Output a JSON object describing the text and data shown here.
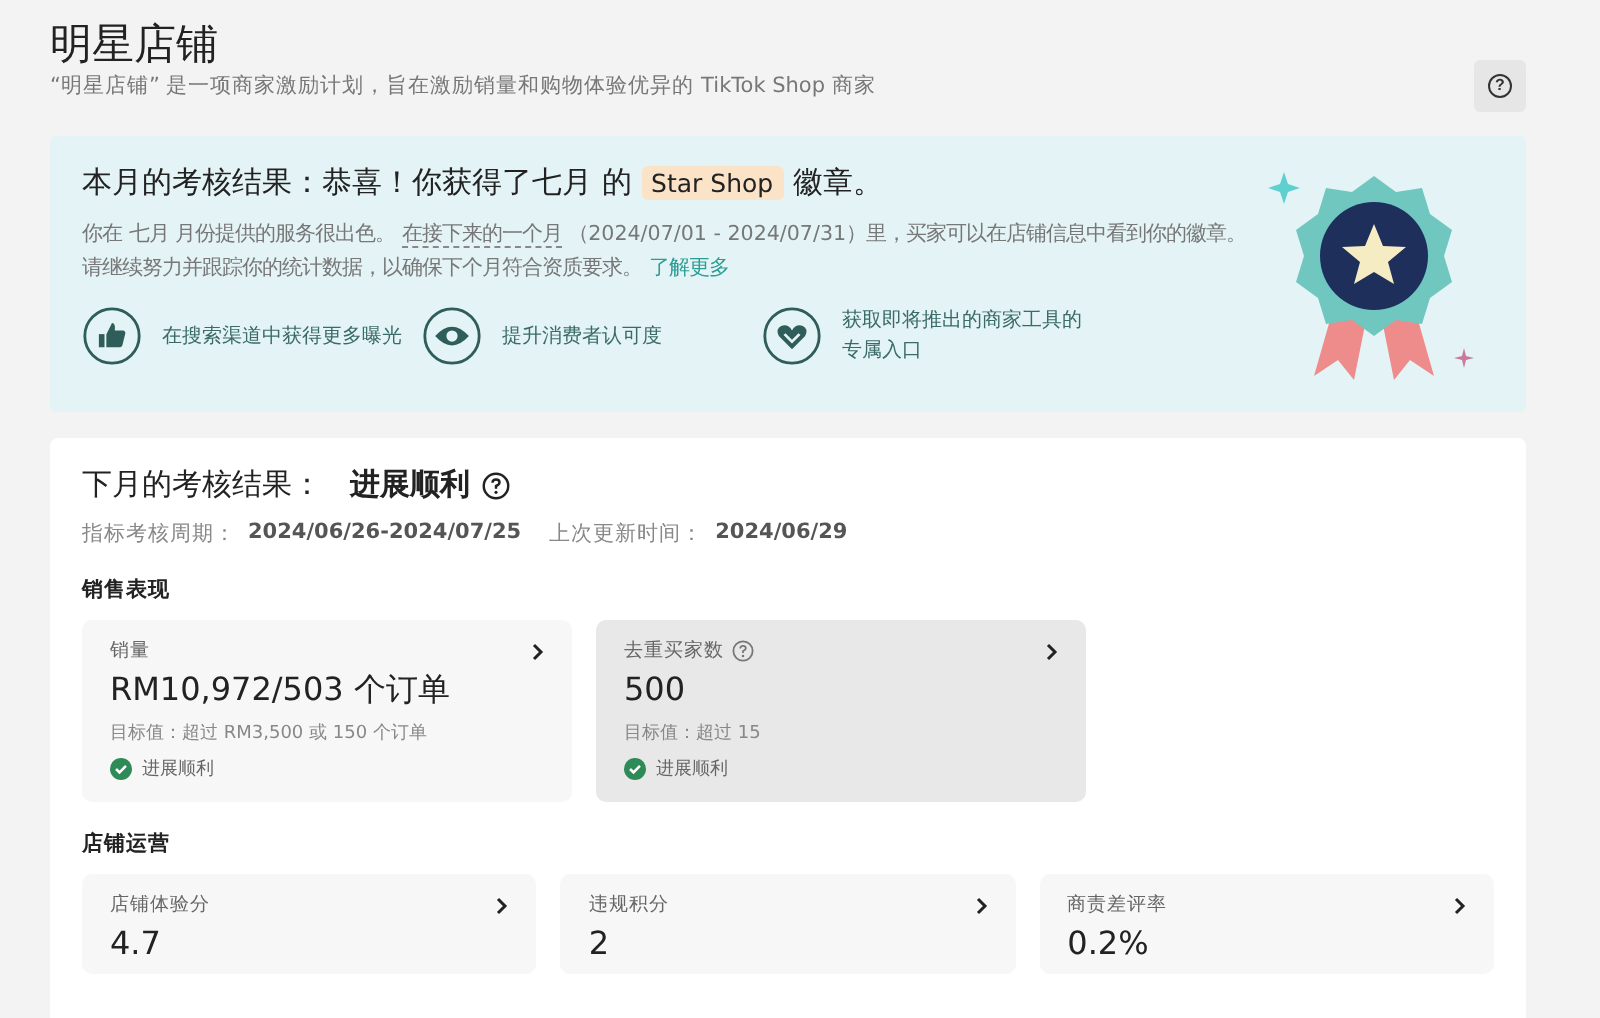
{
  "header": {
    "title": "明星店铺",
    "subtitle": "“明星店铺” 是一项商家激励计划，旨在激励销量和购物体验优异的 TikTok Shop 商家",
    "help_button": "?"
  },
  "banner": {
    "headline_before": "本月的考核结果：恭喜！你获得了七月 的",
    "highlight": "Star Shop",
    "headline_after": "徽章。",
    "text_before": "你在 七月 月份提供的服务很出色。",
    "text_term": "在接下来的一个月",
    "text_after": "（2024/07/01 - 2024/07/31）里，买家可以在店铺信息中看到你的徽章。请继续努力并跟踪你的统计数据，以确保下个月符合资质要求。",
    "link": "了解更多",
    "benefits": [
      {
        "kind": "thumb",
        "label": "在搜索渠道中获得更多曝光"
      },
      {
        "kind": "eye",
        "label": "提升消费者认可度"
      },
      {
        "kind": "heart",
        "label": "获取即将推出的商家工具的专属入口"
      }
    ]
  },
  "next_month": {
    "title": "下月的考核结果：",
    "status": "进展顺利",
    "meta": [
      {
        "label": "指标考核周期：",
        "value": "2024/06/26-2024/07/25"
      },
      {
        "label": "上次更新时间：",
        "value": "2024/06/29"
      }
    ],
    "sections": [
      {
        "title": "销售表现",
        "cards": [
          {
            "name": "销量",
            "help": false,
            "value": "RM10,972/503 个订单",
            "target": "目标值：超过 RM3,500 或 150 个订单",
            "status": "进展顺利",
            "selected": false
          },
          {
            "name": "去重买家数",
            "help": true,
            "value": "500",
            "target": "目标值：超过 15",
            "status": "进展顺利",
            "selected": true
          }
        ]
      },
      {
        "title": "店铺运营",
        "cards": [
          {
            "name": "店铺体验分",
            "help": false,
            "value": "4.7",
            "selected": false
          },
          {
            "name": "违规积分",
            "help": false,
            "value": "2",
            "selected": false
          },
          {
            "name": "商责差评率",
            "help": false,
            "value": "0.2%",
            "selected": false
          }
        ]
      }
    ]
  }
}
